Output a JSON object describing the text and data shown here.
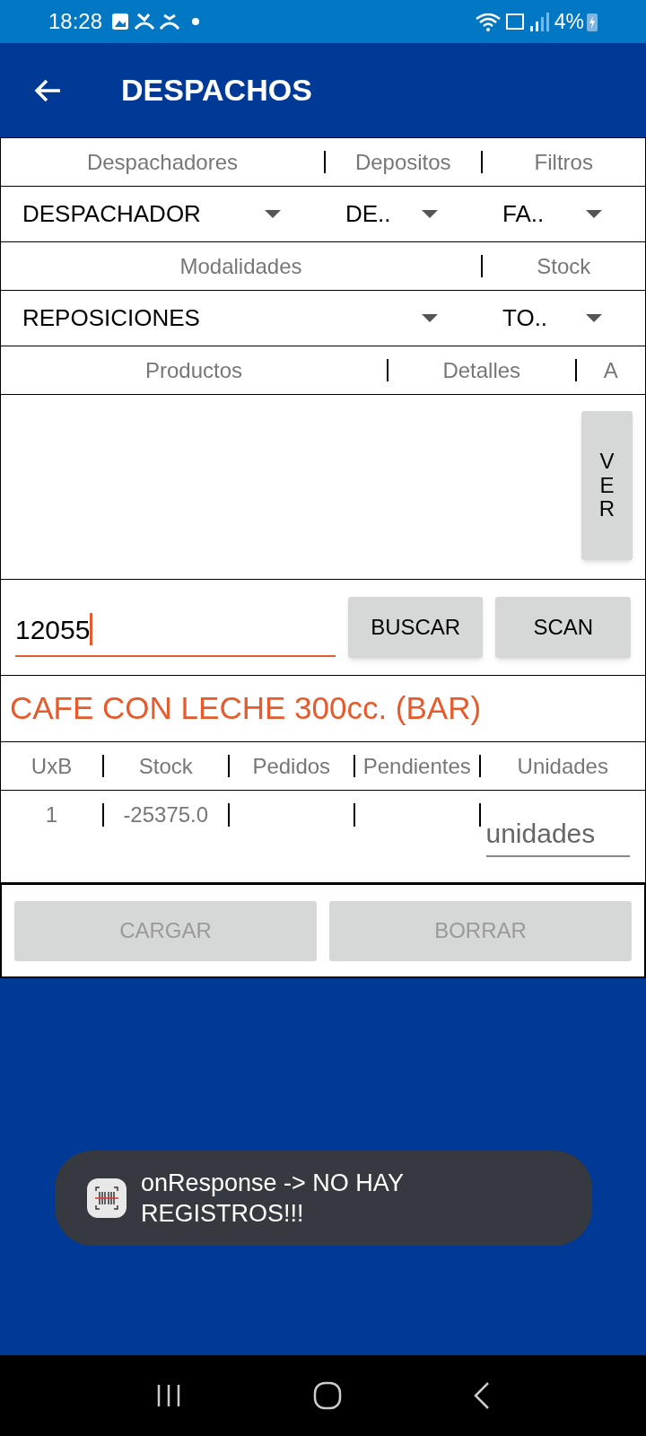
{
  "status_bar": {
    "time": "18:28",
    "battery": "4%"
  },
  "app_bar": {
    "title": "DESPACHOS"
  },
  "filter_headers": [
    "Despachadores",
    "Depositos",
    "Filtros"
  ],
  "filter_spinners": [
    "DESPACHADOR",
    "DE..",
    "FA.."
  ],
  "mode_headers": [
    "Modalidades",
    "Stock"
  ],
  "mode_spinners": [
    "REPOSICIONES",
    "TO.."
  ],
  "list_headers": [
    "Productos",
    "Detalles",
    "A"
  ],
  "view_button": "VER",
  "search": {
    "value": "12055",
    "search_button": "BUSCAR",
    "scan_button": "SCAN"
  },
  "product_name": "CAFE CON LECHE 300cc. (BAR)",
  "table": {
    "columns": [
      "UxB",
      "Stock",
      "Pedidos",
      "Pendientes",
      "Unidades"
    ],
    "row": {
      "uxb": "1",
      "stock": "-25375.0",
      "units_placeholder": "unidades"
    }
  },
  "actions": [
    {
      "label": "CARGAR",
      "disabled": true
    },
    {
      "label": "BORRAR",
      "disabled": true
    }
  ],
  "toast": {
    "message": "onResponse -> NO HAY REGISTROS!!!"
  }
}
